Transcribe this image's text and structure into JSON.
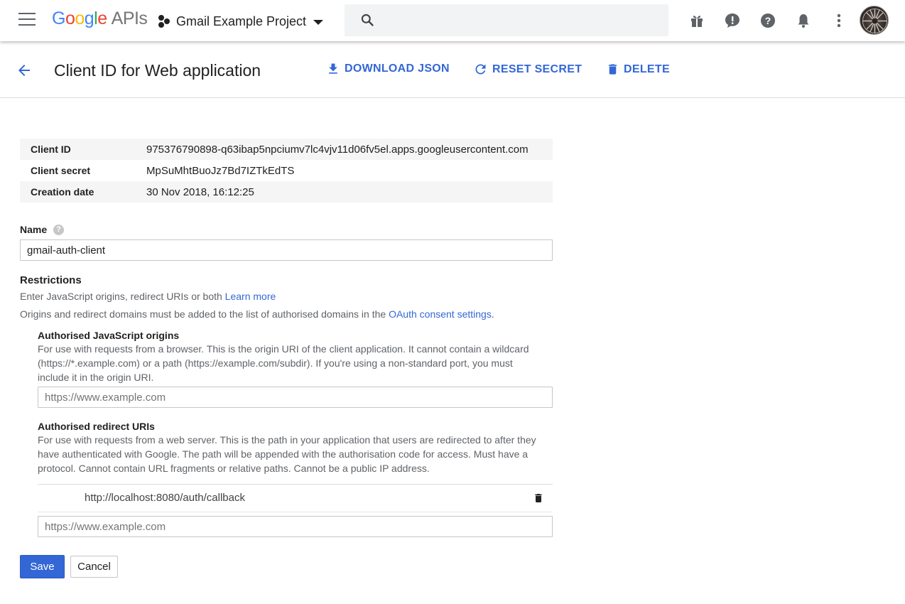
{
  "topbar": {
    "logo_letters": [
      "G",
      "o",
      "o",
      "g",
      "l",
      "e"
    ],
    "logo_suffix": "APIs",
    "project_name": "Gmail Example Project",
    "search_placeholder": ""
  },
  "header": {
    "title": "Client ID for Web application",
    "actions": {
      "download": "DOWNLOAD JSON",
      "reset": "RESET SECRET",
      "delete": "DELETE"
    }
  },
  "info": {
    "rows": [
      {
        "label": "Client ID",
        "value": "975376790898-q63ibap5npciumv7lc4vjv11d06fv5el.apps.googleusercontent.com"
      },
      {
        "label": "Client secret",
        "value": "MpSuMhtBuoJz7Bd7IZTkEdTS"
      },
      {
        "label": "Creation date",
        "value": "30 Nov 2018, 16:12:25"
      }
    ]
  },
  "form": {
    "name_label": "Name",
    "help_glyph": "?",
    "name_value": "gmail-auth-client",
    "restrictions_title": "Restrictions",
    "restrictions_desc": "Enter JavaScript origins, redirect URIs or both ",
    "learn_more": "Learn more",
    "origins_note": "Origins and redirect domains must be added to the list of authorised domains in the ",
    "oauth_link": "OAuth consent settings",
    "oauth_suffix": ".",
    "js_origins": {
      "title": "Authorised JavaScript origins",
      "desc_line1": "For use with requests from a browser. This is the origin URI of the client application. It cannot contain a wildcard",
      "desc_line2": "(https://*.example.com) or a path (https://example.com/subdir). If you're using a non-standard port, you must",
      "desc_line3": "include it in the origin URI.",
      "placeholder": "https://www.example.com"
    },
    "redirect_uris": {
      "title": "Authorised redirect URIs",
      "desc_line1": "For use with requests from a web server. This is the path in your application that users are redirected to after they",
      "desc_line2": "have authenticated with Google. The path will be appended with the authorisation code for access. Must have a",
      "desc_line3": "protocol. Cannot contain URL fragments or relative paths. Cannot be a public IP address.",
      "existing": "http://localhost:8080/auth/callback",
      "placeholder": "https://www.example.com"
    },
    "save_label": "Save",
    "cancel_label": "Cancel"
  },
  "icons": {
    "menu": "hamburger-menu-icon",
    "project": "project-dots-icon",
    "search": "search-icon",
    "gift": "gift-icon",
    "feedback": "feedback-icon",
    "help": "help-icon",
    "notifications": "bell-icon",
    "more": "more-vert-icon",
    "back": "arrow-back-icon",
    "download": "download-icon",
    "refresh": "refresh-icon",
    "delete": "trash-icon"
  },
  "colors": {
    "accent": "#3367d6",
    "text": "#212121",
    "muted": "#5f6368"
  }
}
